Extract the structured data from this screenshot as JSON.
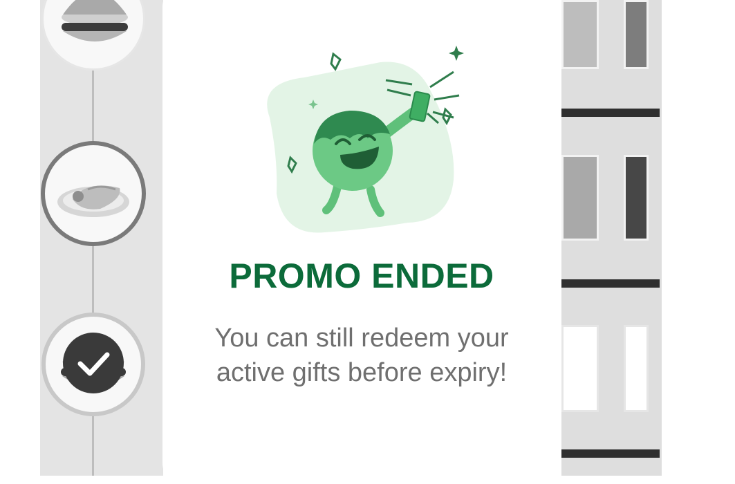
{
  "modal": {
    "title": "PROMO ENDED",
    "message": "You can still redeem your active gifts before expiry!",
    "illustration": "celebrating-mascot-icon"
  },
  "progress_track": {
    "steps": [
      {
        "item": "burger-icon",
        "state": "upcoming"
      },
      {
        "item": "chicken-plate-icon",
        "state": "current"
      },
      {
        "item": "burger-icon",
        "state": "completed",
        "badge": "checkmark-icon"
      }
    ]
  },
  "colors": {
    "title_green": "#0c6b3a",
    "mascot_green": "#5fc07a",
    "blob_green": "#e3f4e6",
    "message_gray": "#6f6f6f",
    "check_badge": "#3a3a3a"
  }
}
